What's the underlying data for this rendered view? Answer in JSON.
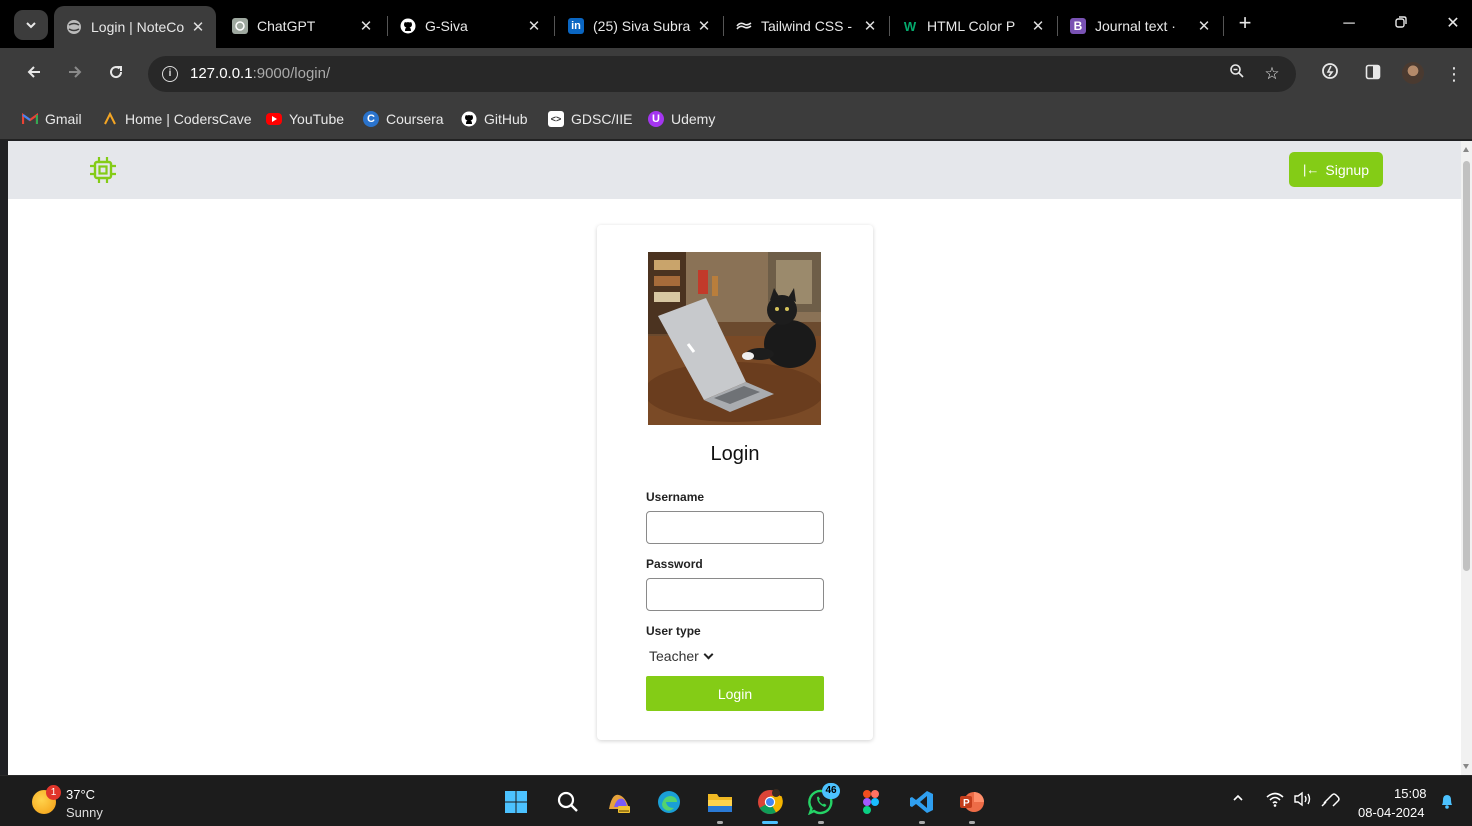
{
  "browser": {
    "tabs": [
      {
        "label": "Login | NoteCo",
        "icon": "globe-icon",
        "active": true
      },
      {
        "label": "ChatGPT",
        "icon": "chatgpt-icon"
      },
      {
        "label": "G-Siva",
        "icon": "github-icon"
      },
      {
        "label": "(25) Siva Subra",
        "icon": "linkedin-icon"
      },
      {
        "label": "Tailwind CSS -",
        "icon": "tailwind-icon"
      },
      {
        "label": "HTML Color P",
        "icon": "w3-icon"
      },
      {
        "label": "Journal text ·",
        "icon": "bootstrap-icon"
      }
    ],
    "address": {
      "host": "127.0.0.1",
      "rest": ":9000/login/"
    },
    "bookmarks": [
      {
        "label": "Gmail",
        "icon": "gmail-icon"
      },
      {
        "label": "Home | CodersCave",
        "icon": "coderscave-icon"
      },
      {
        "label": "YouTube",
        "icon": "youtube-icon"
      },
      {
        "label": "Coursera",
        "icon": "coursera-icon"
      },
      {
        "label": "GitHub",
        "icon": "github-icon"
      },
      {
        "label": "GDSC/IIE",
        "icon": "gdsc-icon"
      },
      {
        "label": "Udemy",
        "icon": "udemy-icon"
      }
    ]
  },
  "page": {
    "header": {
      "logo_icon": "chip-icon",
      "signup_label": "Signup"
    },
    "card": {
      "title": "Login",
      "username_label": "Username",
      "username_value": "",
      "password_label": "Password",
      "password_value": "",
      "user_type_label": "User type",
      "user_type_value": "Teacher",
      "submit_label": "Login"
    },
    "colors": {
      "accent": "#84cc16",
      "header_bg": "#e5e7eb"
    }
  },
  "taskbar": {
    "weather": {
      "temp": "37°C",
      "condition": "Sunny",
      "badge": "1"
    },
    "whatsapp_badge": "46",
    "clock": {
      "time": "15:08",
      "date": "08-04-2024"
    }
  }
}
